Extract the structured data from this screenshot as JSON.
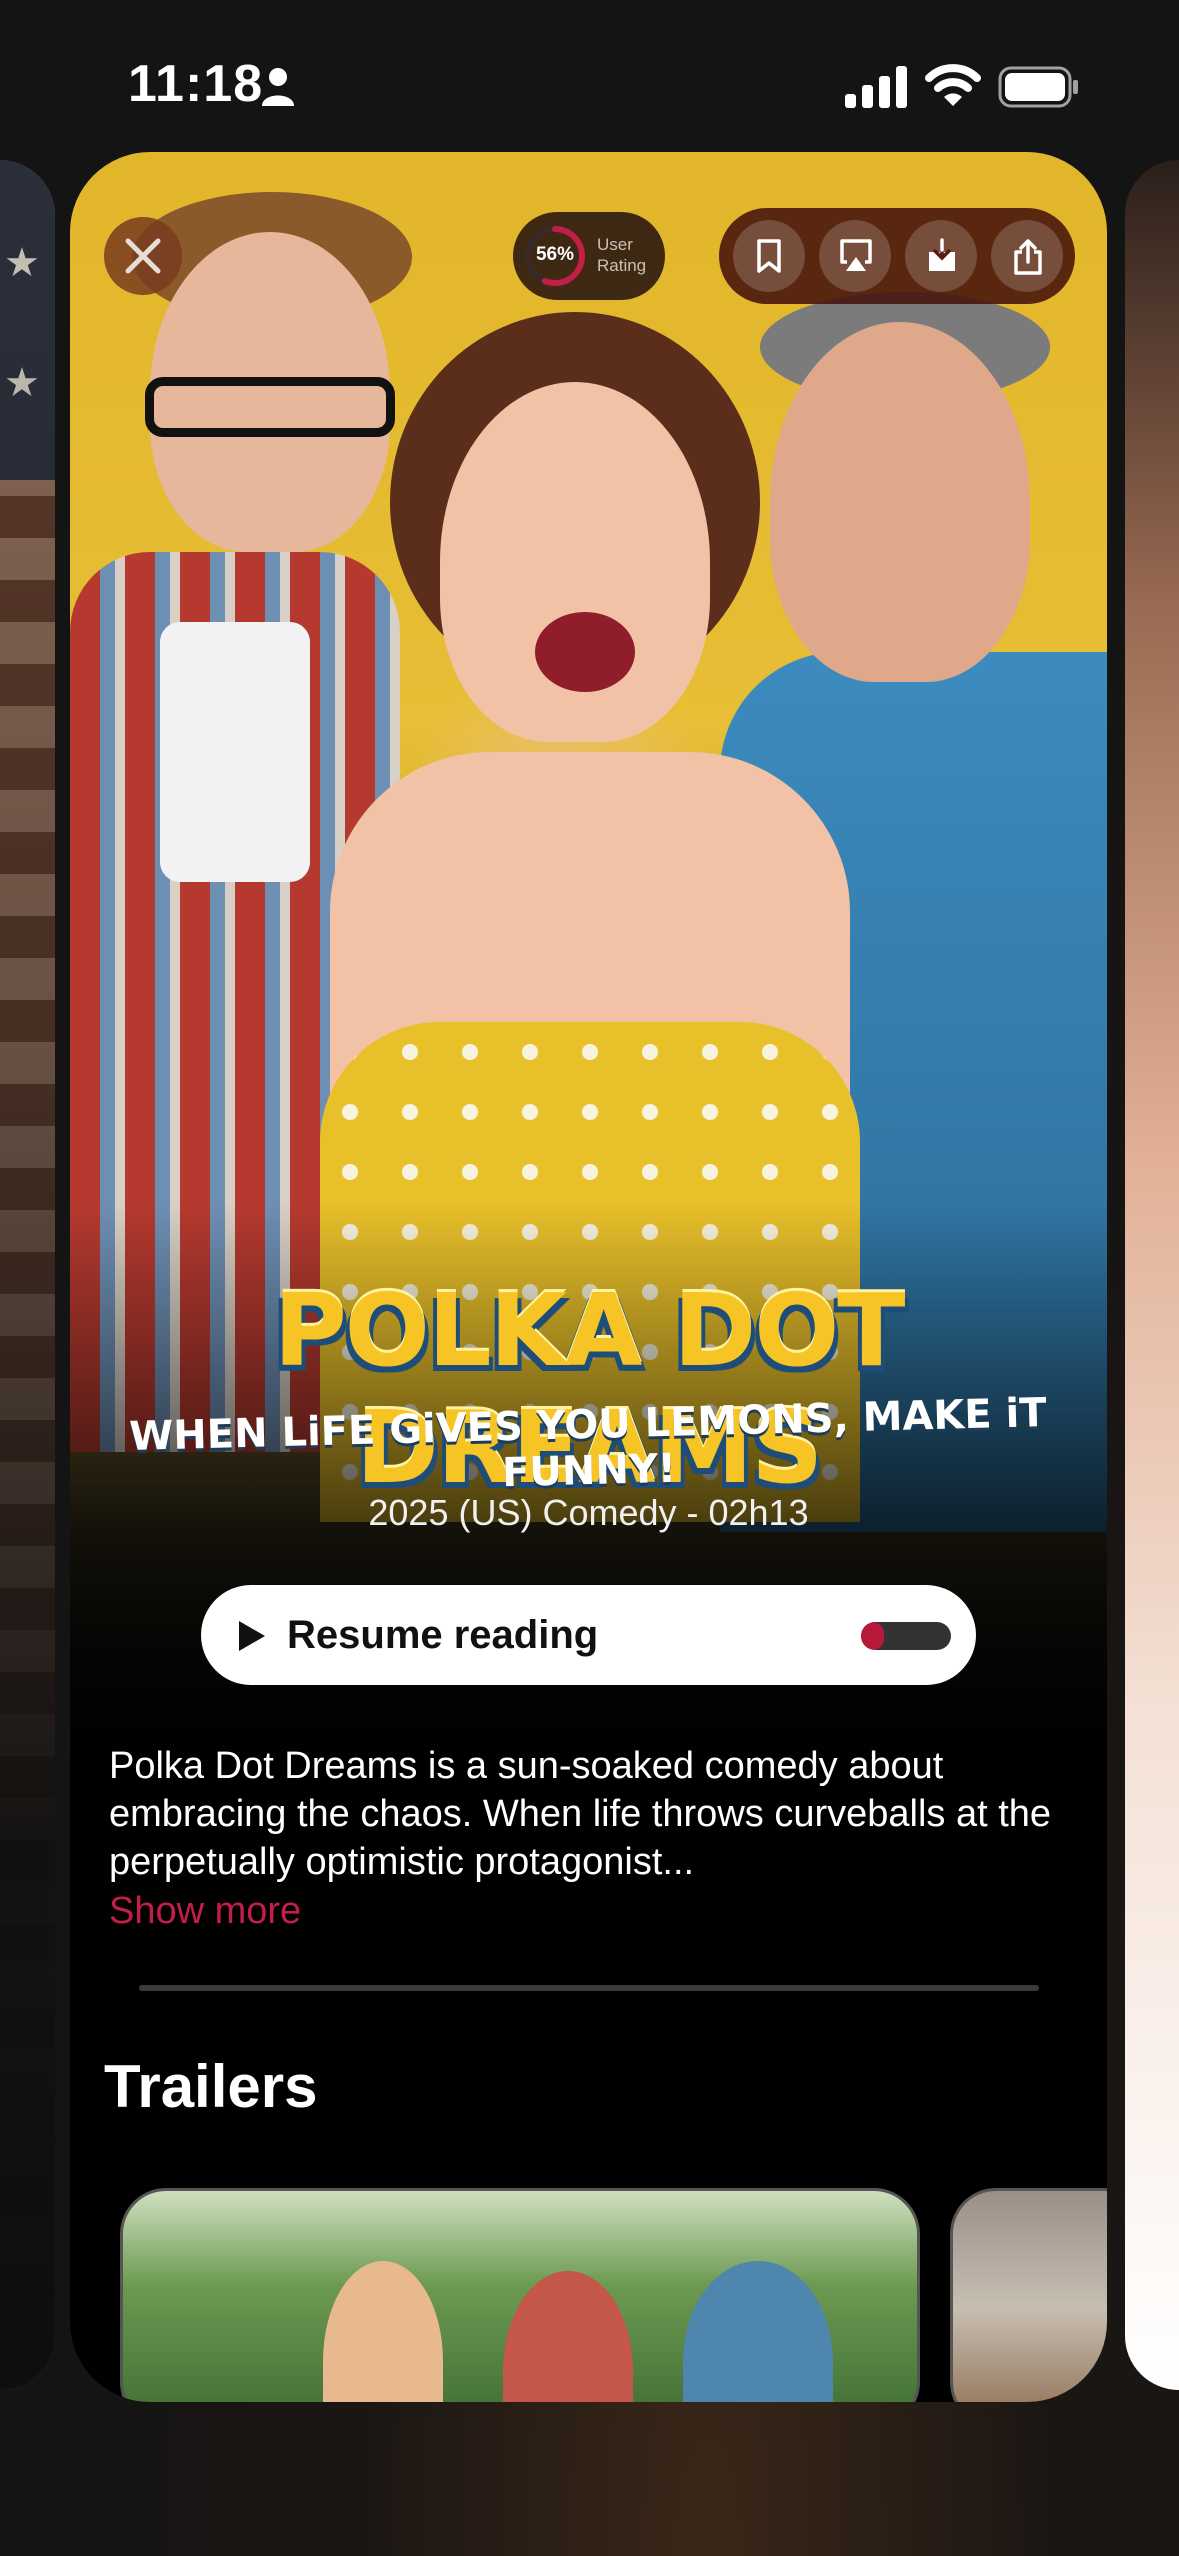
{
  "status_bar": {
    "time": "11:18"
  },
  "header": {
    "rating": {
      "value": "56%",
      "percent": 56,
      "label": "User Rating"
    }
  },
  "movie": {
    "title": "POLKA DOT DREAMS",
    "tagline": "WHEN LiFE GiVES YOU LEMONS, MAKE iT FUNNY!",
    "meta": "2025 (US) Comedy - 02h13",
    "resume_label": "Resume reading",
    "progress_percent": 25,
    "description": "Polka Dot Dreams is a sun-soaked comedy about embracing the chaos. When life throws curveballs at the perpetually optimistic protagonist...",
    "show_more": "Show more"
  },
  "trailers": {
    "title": "Trailers"
  },
  "colors": {
    "accent": "#c21e47",
    "progress": "#b8193a"
  },
  "icons": [
    "person-icon",
    "signal-icon",
    "wifi-icon",
    "battery-icon",
    "close-icon",
    "bookmark-icon",
    "airplay-icon",
    "download-icon",
    "share-icon",
    "play-icon"
  ]
}
